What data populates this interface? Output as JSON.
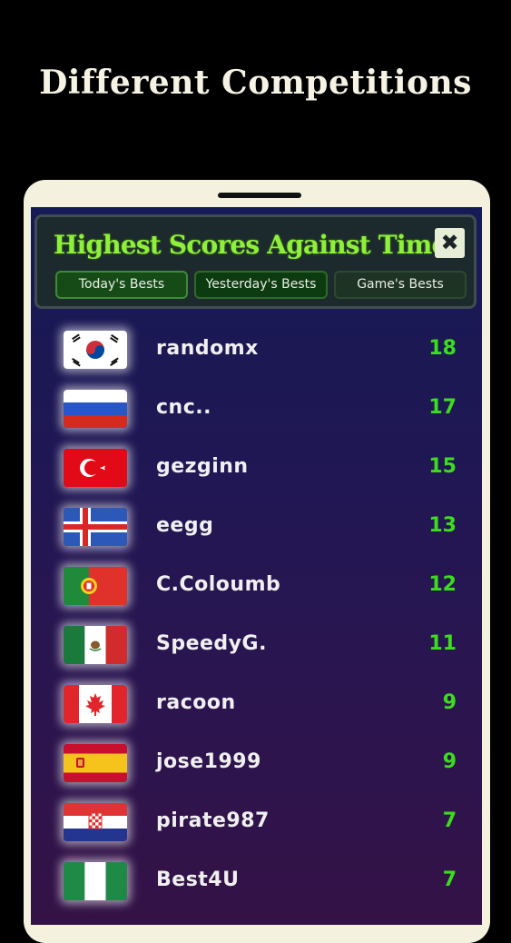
{
  "headline": "Different Competitions",
  "panel": {
    "title": "Highest Scores Against Time",
    "close_label": "✖",
    "tabs": [
      "Today's Bests",
      "Yesterday's Bests",
      "Game's Bests"
    ]
  },
  "leaderboard": [
    {
      "flag": "south-korea-flag",
      "name": "randomx",
      "score": "18"
    },
    {
      "flag": "russia-flag",
      "name": "cnc..",
      "score": "17"
    },
    {
      "flag": "turkey-flag",
      "name": "gezginn",
      "score": "15"
    },
    {
      "flag": "iceland-flag",
      "name": "eegg",
      "score": "13"
    },
    {
      "flag": "portugal-flag",
      "name": "C.Coloumb",
      "score": "12"
    },
    {
      "flag": "mexico-flag",
      "name": "SpeedyG.",
      "score": "11"
    },
    {
      "flag": "canada-flag",
      "name": "racoon",
      "score": "9"
    },
    {
      "flag": "spain-flag",
      "name": "jose1999",
      "score": "9"
    },
    {
      "flag": "croatia-flag",
      "name": "pirate987",
      "score": "7"
    },
    {
      "flag": "nigeria-flag",
      "name": "Best4U",
      "score": "7"
    }
  ],
  "colors": {
    "title_green": "#8ef03a",
    "score_green": "#3ddc1e",
    "panel_bg": "#1d2a2d"
  }
}
